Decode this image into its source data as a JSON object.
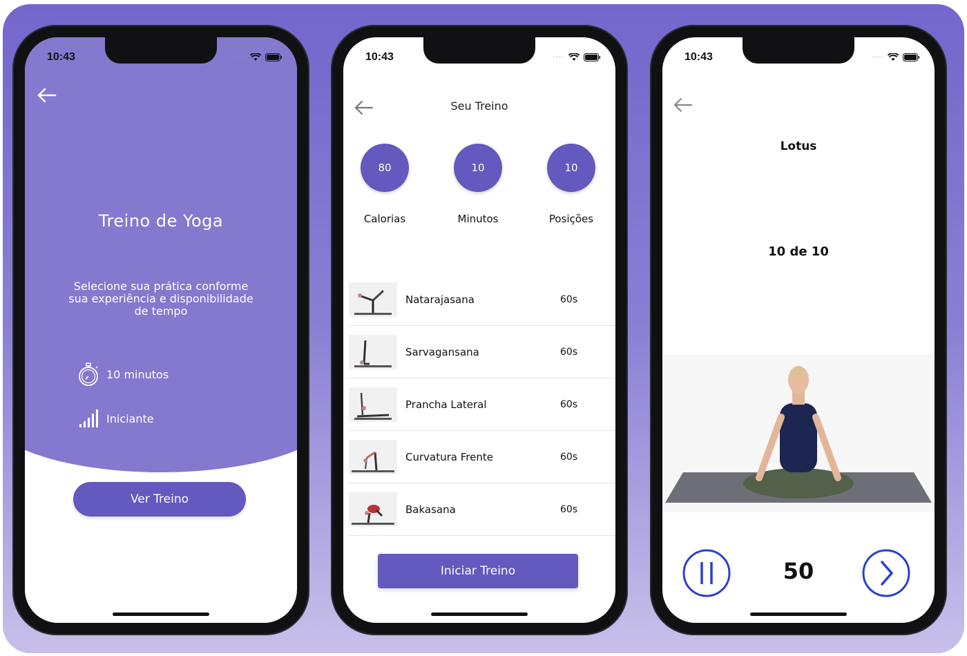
{
  "status": {
    "time": "10:43"
  },
  "screen1": {
    "title": "Treino de Yoga",
    "description_lines": [
      "Selecione sua prática conforme",
      "sua experiência e disponibilidade",
      "de tempo"
    ],
    "duration": "10 minutos",
    "level": "Iniciante",
    "button": "Ver Treino"
  },
  "screen2": {
    "header": "Seu Treino",
    "stats": [
      {
        "value": "80",
        "label": "Calorias"
      },
      {
        "value": "10",
        "label": "Minutos"
      },
      {
        "value": "10",
        "label": "Posições"
      }
    ],
    "exercises": [
      {
        "name": "Natarajasana",
        "duration": "60s"
      },
      {
        "name": "Sarvagansana",
        "duration": "60s"
      },
      {
        "name": "Prancha Lateral",
        "duration": "60s"
      },
      {
        "name": "Curvatura Frente",
        "duration": "60s"
      },
      {
        "name": "Bakasana",
        "duration": "60s"
      }
    ],
    "button": "Iniciar Treino"
  },
  "screen3": {
    "pose": "Lotus",
    "progress": "10 de 10",
    "timer": "50"
  },
  "colors": {
    "primary": "#6459bf",
    "header_bg": "#8479cf",
    "control_blue": "#2a3fd0"
  }
}
